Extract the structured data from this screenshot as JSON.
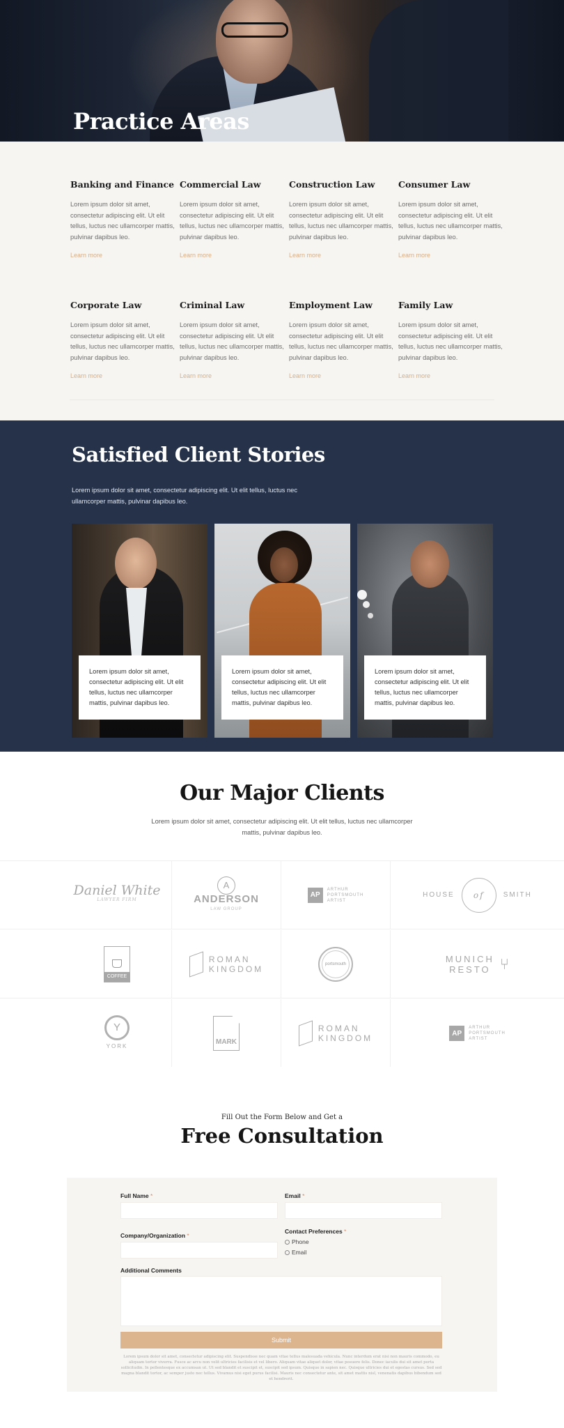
{
  "hero": {
    "title": "Practice Areas"
  },
  "practice_areas": [
    {
      "title": "Banking and Finance",
      "text": "Lorem ipsum dolor sit amet, consectetur adipiscing elit. Ut elit tellus, luctus nec ullamcorper mattis, pulvinar dapibus leo.",
      "link": "Learn more"
    },
    {
      "title": "Commercial Law",
      "text": "Lorem ipsum dolor sit amet, consectetur adipiscing elit. Ut elit tellus, luctus nec ullamcorper mattis, pulvinar dapibus leo.",
      "link": "Learn more"
    },
    {
      "title": "Construction Law",
      "text": "Lorem ipsum dolor sit amet, consectetur adipiscing elit. Ut elit tellus, luctus nec ullamcorper mattis, pulvinar dapibus leo.",
      "link": "Learn more"
    },
    {
      "title": "Consumer Law",
      "text": "Lorem ipsum dolor sit amet, consectetur adipiscing elit. Ut elit tellus, luctus nec ullamcorper mattis, pulvinar dapibus leo.",
      "link": "Learn more"
    },
    {
      "title": "Corporate Law",
      "text": "Lorem ipsum dolor sit amet, consectetur adipiscing elit. Ut elit tellus, luctus nec ullamcorper mattis, pulvinar dapibus leo.",
      "link": "Learn more"
    },
    {
      "title": "Criminal Law",
      "text": "Lorem ipsum dolor sit amet, consectetur adipiscing elit. Ut elit tellus, luctus nec ullamcorper mattis, pulvinar dapibus leo.",
      "link": "Learn more"
    },
    {
      "title": "Employment Law",
      "text": "Lorem ipsum dolor sit amet, consectetur adipiscing elit. Ut elit tellus, luctus nec ullamcorper mattis, pulvinar dapibus leo.",
      "link": "Learn more"
    },
    {
      "title": "Family Law",
      "text": "Lorem ipsum dolor sit amet, consectetur adipiscing elit. Ut elit tellus, luctus nec ullamcorper mattis, pulvinar dapibus leo.",
      "link": "Learn more"
    }
  ],
  "stories": {
    "title": "Satisfied Client Stories",
    "intro": "Lorem ipsum dolor sit amet, consectetur adipiscing elit. Ut elit tellus, luctus nec ullamcorper mattis, pulvinar dapibus leo.",
    "cards": [
      {
        "quote": "Lorem ipsum dolor sit amet, consectetur adipiscing elit. Ut elit tellus, luctus nec ullamcorper mattis, pulvinar dapibus leo."
      },
      {
        "quote": "Lorem ipsum dolor sit amet, consectetur adipiscing elit. Ut elit tellus, luctus nec ullamcorper mattis, pulvinar dapibus leo."
      },
      {
        "quote": "Lorem ipsum dolor sit amet, consectetur adipiscing elit. Ut elit tellus, luctus nec ullamcorper mattis, pulvinar dapibus leo."
      }
    ]
  },
  "clients": {
    "title": "Our Major Clients",
    "intro": "Lorem ipsum dolor sit amet, consectetur adipiscing elit. Ut elit tellus, luctus nec ullamcorper mattis, pulvinar dapibus leo.",
    "logos": {
      "daniel_white": "Daniel White",
      "daniel_white_sub": "LAWYER FIRM",
      "anderson_letter": "A",
      "anderson": "ANDERSON",
      "anderson_sub": "LAW GROUP",
      "ap_mark": "AP",
      "arthur": "ARTHUR",
      "portsmouth": "PORTSMOUTH",
      "artist": "ARTIST",
      "house_left": "HOUSE",
      "house_of": "of",
      "house_right": "SMITH",
      "coffee": "COFFEE",
      "roman": "ROMAN",
      "kingdom": "KINGDOM",
      "portsmouth_badge": "portsmouth",
      "munich": "MUNICH",
      "resto": "RESTO",
      "york_letter": "Y",
      "york": "YORK",
      "mark": "MARK",
      "roman2": "ROMAN",
      "kingdom2": "KINGDOM",
      "ap_mark2": "AP",
      "arthur2": "ARTHUR",
      "portsmouth2": "PORTSMOUTH",
      "artist2": "ARTIST"
    }
  },
  "consultation": {
    "kicker": "Fill Out the Form Below and Get a",
    "title": "Free Consultation",
    "labels": {
      "full_name": "Full Name",
      "email": "Email",
      "company": "Company/Organization",
      "contact_prefs": "Contact Preferences",
      "comments": "Additional Comments",
      "required_mark": "*"
    },
    "options": {
      "phone": "Phone",
      "email": "Email"
    },
    "submit": "Submit",
    "fineprint": "Lorem ipsum dolor sit amet, consectetur adipiscing elit. Suspendisse nec quam vitae tellus malesuada vehicula. Nunc interdum erat nisi non mauris commodo, eu aliquam tortor viverra. Fusce ac arcu non velit ultricies facilisis et vel libero. Aliquam vitae aliquet dolor, vitae posuere felis. Donec iaculis dui sit amet porta sollicitudin. In pellentesque ex accumsan ut. Ut sed blandit et suscipit et, suscipit sed ipsum. Quisque in sapien nec. Quisque ultricies dui et egestas cursus. Sed sed magna blandit tortor, ac semper justo nec tellus. Vivamus nisi eget purus facilisi. Mauris nec consectetur ante, sit amet mattis nisl, venenatis dapibus bibendum sed et hendrerit."
  },
  "colors": {
    "navy": "#25324a",
    "accent": "#dcb58f",
    "beige": "#f7f5f2"
  }
}
